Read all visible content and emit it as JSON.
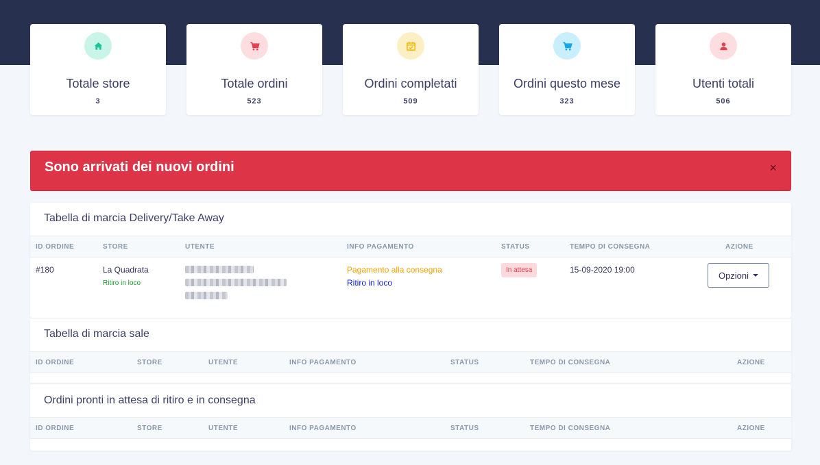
{
  "colors": {
    "top_band": "#283050",
    "alert_bg": "#de3447",
    "payment_method": "#f5a200",
    "delivery_type": "#0a1dd0",
    "store_subtype": "#1b9a2c"
  },
  "stats": [
    {
      "label": "Totale store",
      "value": "3",
      "icon": "home-icon",
      "icon_color": "#1bc49a",
      "icon_bg": "#c8f5e8"
    },
    {
      "label": "Totale ordini",
      "value": "523",
      "icon": "cart-icon",
      "icon_color": "#e5404f",
      "icon_bg": "#fddde0"
    },
    {
      "label": "Ordini completati",
      "value": "509",
      "icon": "calendar-check-icon",
      "icon_color": "#f7b500",
      "icon_bg": "#fdefc4"
    },
    {
      "label": "Ordini questo mese",
      "value": "323",
      "icon": "cart-icon",
      "icon_color": "#12a8e8",
      "icon_bg": "#c9eefc"
    },
    {
      "label": "Utenti totali",
      "value": "506",
      "icon": "user-icon",
      "icon_color": "#e5404f",
      "icon_bg": "#fddde0"
    }
  ],
  "alert": {
    "text": "Sono arrivati dei nuovi ordini",
    "close": "×"
  },
  "tables": [
    {
      "title": "Tabella di marcia Delivery/Take Away",
      "headers": [
        "ID ORDINE",
        "STORE",
        "UTENTE",
        "INFO PAGAMENTO",
        "STATUS",
        "TEMPO DI CONSEGNA",
        "AZIONE"
      ],
      "rows": [
        {
          "id": "#180",
          "store": "La Quadrata",
          "store_sub": "Ritiro in loco",
          "payment": "Pagamento alla consegna",
          "delivery": "Ritiro in loco",
          "status": "In attesa",
          "time": "15-09-2020 19:00",
          "action": "Opzioni"
        }
      ]
    },
    {
      "title": "Tabella di marcia sale",
      "headers": [
        "ID ORDINE",
        "STORE",
        "UTENTE",
        "INFO PAGAMENTO",
        "STATUS",
        "TEMPO DI CONSEGNA",
        "AZIONE"
      ],
      "rows": []
    },
    {
      "title": "Ordini pronti in attesa di ritiro e in consegna",
      "headers": [
        "ID ORDINE",
        "STORE",
        "UTENTE",
        "INFO PAGAMENTO",
        "STATUS",
        "TEMPO DI CONSEGNA",
        "AZIONE"
      ],
      "rows": []
    }
  ]
}
